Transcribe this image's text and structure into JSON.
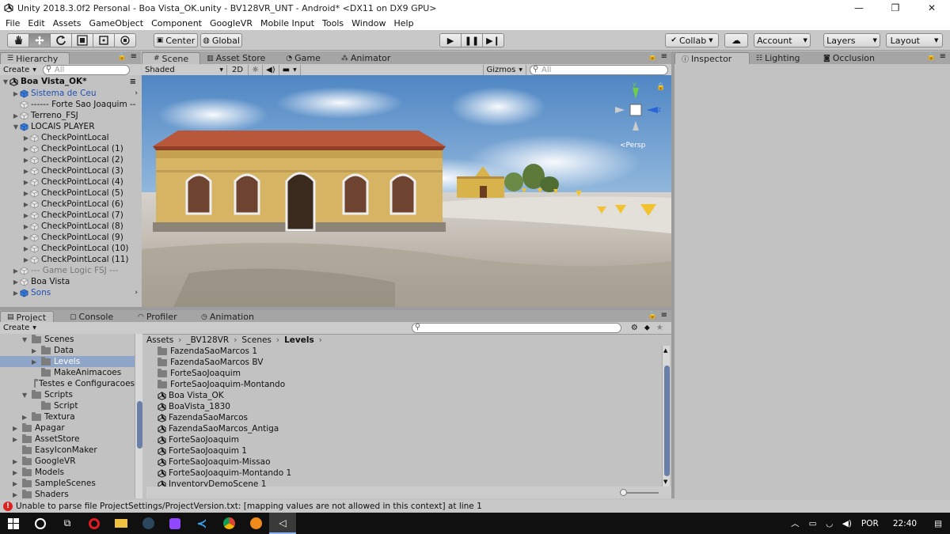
{
  "window": {
    "title": "Unity 2018.3.0f2 Personal - Boa Vista_OK.unity - BV128VR_UNT - Android* <DX11 on DX9 GPU>",
    "controls": [
      "—",
      "❐",
      "✕"
    ]
  },
  "menu": [
    "File",
    "Edit",
    "Assets",
    "GameObject",
    "Component",
    "GoogleVR",
    "Mobile Input",
    "Tools",
    "Window",
    "Help"
  ],
  "toolbar": {
    "pivot": "Center",
    "space": "Global",
    "collab": "Collab",
    "account": "Account",
    "layers": "Layers",
    "layout": "Layout"
  },
  "hierarchy": {
    "tab": "Hierarchy",
    "create": "Create",
    "search_placeholder": "All",
    "scene_name": "Boa Vista_OK*",
    "items": [
      {
        "label": "Sistema de Ceu",
        "indent": 1,
        "arrow": "▶",
        "blue": true,
        "icon": "prefab"
      },
      {
        "label": "------ Forte Sao Joaquim --",
        "indent": 1,
        "arrow": "",
        "blue": false,
        "icon": "go"
      },
      {
        "label": "Terreno_FSJ",
        "indent": 1,
        "arrow": "▶",
        "blue": false,
        "icon": "go"
      },
      {
        "label": "LOCAIS PLAYER",
        "indent": 1,
        "arrow": "▼",
        "blue": false,
        "icon": "prefab"
      },
      {
        "label": "CheckPointLocal",
        "indent": 2,
        "arrow": "▶",
        "blue": false,
        "icon": "go"
      },
      {
        "label": "CheckPointLocal (1)",
        "indent": 2,
        "arrow": "▶",
        "blue": false,
        "icon": "go"
      },
      {
        "label": "CheckPointLocal (2)",
        "indent": 2,
        "arrow": "▶",
        "blue": false,
        "icon": "go"
      },
      {
        "label": "CheckPointLocal (3)",
        "indent": 2,
        "arrow": "▶",
        "blue": false,
        "icon": "go"
      },
      {
        "label": "CheckPointLocal (4)",
        "indent": 2,
        "arrow": "▶",
        "blue": false,
        "icon": "go"
      },
      {
        "label": "CheckPointLocal (5)",
        "indent": 2,
        "arrow": "▶",
        "blue": false,
        "icon": "go"
      },
      {
        "label": "CheckPointLocal (6)",
        "indent": 2,
        "arrow": "▶",
        "blue": false,
        "icon": "go"
      },
      {
        "label": "CheckPointLocal (7)",
        "indent": 2,
        "arrow": "▶",
        "blue": false,
        "icon": "go"
      },
      {
        "label": "CheckPointLocal (8)",
        "indent": 2,
        "arrow": "▶",
        "blue": false,
        "icon": "go"
      },
      {
        "label": "CheckPointLocal (9)",
        "indent": 2,
        "arrow": "▶",
        "blue": false,
        "icon": "go"
      },
      {
        "label": "CheckPointLocal (10)",
        "indent": 2,
        "arrow": "▶",
        "blue": false,
        "icon": "go"
      },
      {
        "label": "CheckPointLocal (11)",
        "indent": 2,
        "arrow": "▶",
        "blue": false,
        "icon": "go"
      },
      {
        "label": "--- Game Logic FSJ ---",
        "indent": 1,
        "arrow": "▶",
        "blue": false,
        "icon": "go",
        "dim": true
      },
      {
        "label": "Boa Vista",
        "indent": 1,
        "arrow": "▶",
        "blue": false,
        "icon": "go"
      },
      {
        "label": "Sons",
        "indent": 1,
        "arrow": "▶",
        "blue": true,
        "icon": "prefab"
      }
    ]
  },
  "scene": {
    "tabs": [
      "Scene",
      "Asset Store",
      "Game",
      "Animator"
    ],
    "shading": "Shaded",
    "mode2d": "2D",
    "gizmos": "Gizmos",
    "search_placeholder": "All",
    "persp": "<Persp"
  },
  "inspector": {
    "tabs": [
      "Inspector",
      "Lighting",
      "Occlusion"
    ]
  },
  "project": {
    "tabs": [
      "Project",
      "Console",
      "Profiler",
      "Animation"
    ],
    "create": "Create",
    "tree": [
      {
        "label": "Scenes",
        "indent": 2,
        "arrow": "▼",
        "sel": false
      },
      {
        "label": "Data",
        "indent": 3,
        "arrow": "▶",
        "sel": false
      },
      {
        "label": "Levels",
        "indent": 3,
        "arrow": "▶",
        "sel": true
      },
      {
        "label": "MakeAnimacoes",
        "indent": 3,
        "arrow": "",
        "sel": false
      },
      {
        "label": "Testes e Configuracoes",
        "indent": 3,
        "arrow": "",
        "sel": false
      },
      {
        "label": "Scripts",
        "indent": 2,
        "arrow": "▼",
        "sel": false
      },
      {
        "label": "Script",
        "indent": 3,
        "arrow": "",
        "sel": false
      },
      {
        "label": "Textura",
        "indent": 2,
        "arrow": "▶",
        "sel": false
      },
      {
        "label": "Apagar",
        "indent": 1,
        "arrow": "▶",
        "sel": false
      },
      {
        "label": "AssetStore",
        "indent": 1,
        "arrow": "▶",
        "sel": false
      },
      {
        "label": "EasyIconMaker",
        "indent": 1,
        "arrow": "",
        "sel": false
      },
      {
        "label": "GoogleVR",
        "indent": 1,
        "arrow": "▶",
        "sel": false
      },
      {
        "label": "Models",
        "indent": 1,
        "arrow": "▶",
        "sel": false
      },
      {
        "label": "SampleScenes",
        "indent": 1,
        "arrow": "▶",
        "sel": false
      },
      {
        "label": "Shaders",
        "indent": 1,
        "arrow": "▶",
        "sel": false
      }
    ],
    "breadcrumb": [
      "Assets",
      "_BV128VR",
      "Scenes",
      "Levels"
    ],
    "files": [
      {
        "label": "FazendaSaoMarcos 1",
        "kind": "folder"
      },
      {
        "label": "FazendaSaoMarcos BV",
        "kind": "folder"
      },
      {
        "label": "ForteSaoJoaquim",
        "kind": "folder"
      },
      {
        "label": "ForteSaoJoaquim-Montando",
        "kind": "folder"
      },
      {
        "label": "Boa Vista_OK",
        "kind": "scene"
      },
      {
        "label": "BoaVista_1830",
        "kind": "scene"
      },
      {
        "label": "FazendaSaoMarcos",
        "kind": "scene"
      },
      {
        "label": "FazendaSaoMarcos_Antiga",
        "kind": "scene"
      },
      {
        "label": "ForteSaoJoaquim",
        "kind": "scene"
      },
      {
        "label": "ForteSaoJoaquim 1",
        "kind": "scene"
      },
      {
        "label": "ForteSaoJoaquim-Missao",
        "kind": "scene"
      },
      {
        "label": "ForteSaoJoaquim-Montando 1",
        "kind": "scene"
      },
      {
        "label": "InventoryDemoScene 1",
        "kind": "scene"
      }
    ]
  },
  "status": {
    "message": "Unable to parse file ProjectSettings/ProjectVersion.txt: [mapping values are not allowed in this context] at line 1"
  },
  "taskbar": {
    "language": "POR",
    "time": "22:40"
  }
}
